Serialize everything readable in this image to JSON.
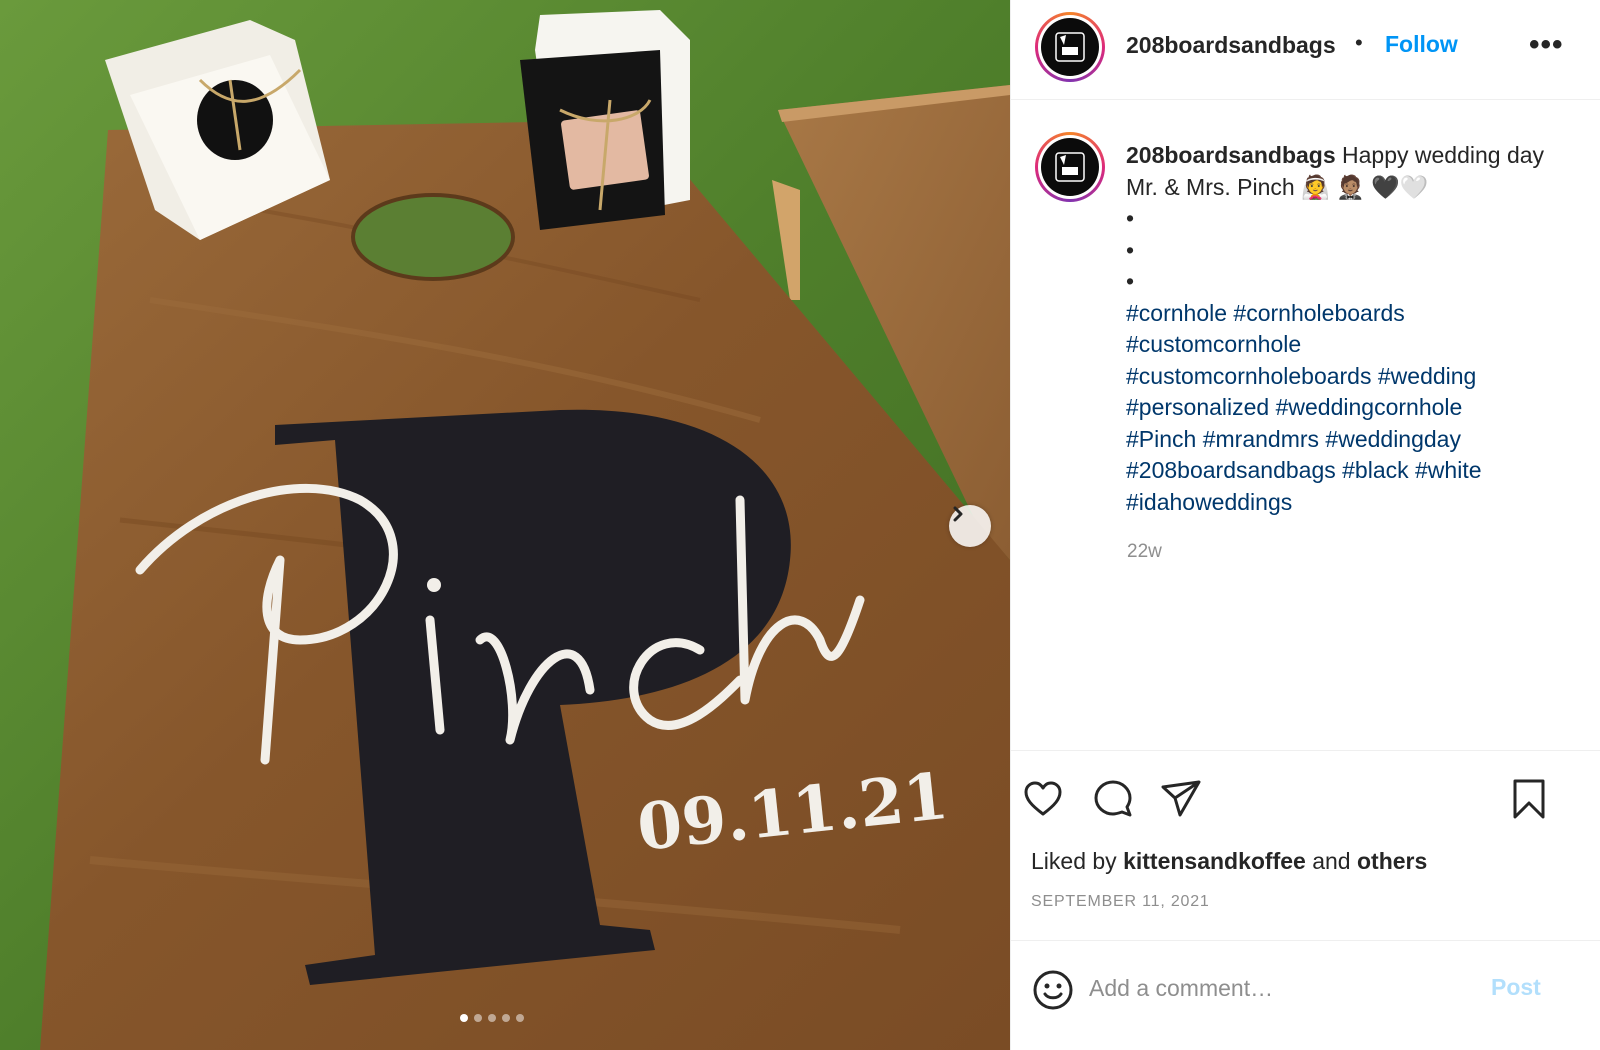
{
  "post": {
    "username": "208boardsandbags",
    "follow_label": "Follow",
    "separator": "•",
    "more_label": "•••",
    "avatar_icon": "boards-and-bags-logo-icon"
  },
  "photo": {
    "board_script_text": "Pinch",
    "board_monogram": "P",
    "board_date": "09.11.21",
    "carousel_count": 5,
    "carousel_active": 1,
    "next_icon": "chevron-right-icon"
  },
  "caption": {
    "username": "208boardsandbags",
    "text": "Happy wedding day Mr. & Mrs. Pinch 👰 🤵🏽 🖤🤍",
    "bullets": [
      "•",
      "•",
      "•"
    ],
    "hashtags": [
      "#cornhole",
      "#cornholeboards",
      "#customcornhole",
      "#customcornholeboards",
      "#wedding",
      "#personalized",
      "#weddingcornhole",
      "#Pinch",
      "#mrandmrs",
      "#weddingday",
      "#208boardsandbags",
      "#black",
      "#white",
      "#idahoweddings"
    ],
    "time_ago": "22w"
  },
  "actions": {
    "icons": [
      "heart-icon",
      "comment-icon",
      "share-icon",
      "bookmark-icon"
    ],
    "liked_by_prefix": "Liked by",
    "liked_by_user": "kittensandkoffee",
    "liked_by_and": "and",
    "liked_by_others": "others",
    "date": "SEPTEMBER 11, 2021"
  },
  "comment": {
    "placeholder": "Add a comment…",
    "post_label": "Post",
    "emoji_icon": "smiley-icon"
  },
  "colors": {
    "link_blue": "#0095f6",
    "hashtag_blue": "#00376b",
    "muted_gray": "#8e8e8e",
    "post_disabled": "#b2dffc",
    "board_wood": "#8a5a2e",
    "monogram_black": "#1f1e24"
  }
}
